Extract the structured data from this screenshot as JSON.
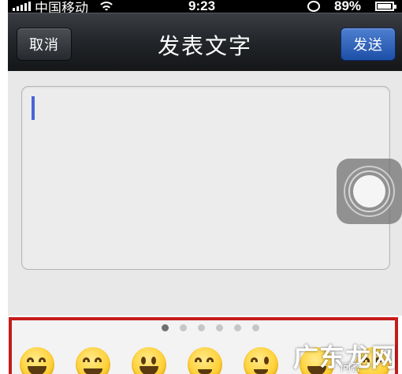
{
  "status_bar": {
    "carrier": "中国移动",
    "time": "9:23",
    "battery": "89%"
  },
  "nav": {
    "cancel_label": "取消",
    "title": "发表文字",
    "send_label": "发送"
  },
  "compose": {
    "text": ""
  },
  "emoji_panel": {
    "page_count": 6,
    "active_page": 1
  },
  "watermark": {
    "text": "广东龙网",
    "sub": "问答"
  },
  "colors": {
    "send_button": "#2d5fbc",
    "panel_border": "#c61b1b",
    "caret": "#4a64d8"
  }
}
